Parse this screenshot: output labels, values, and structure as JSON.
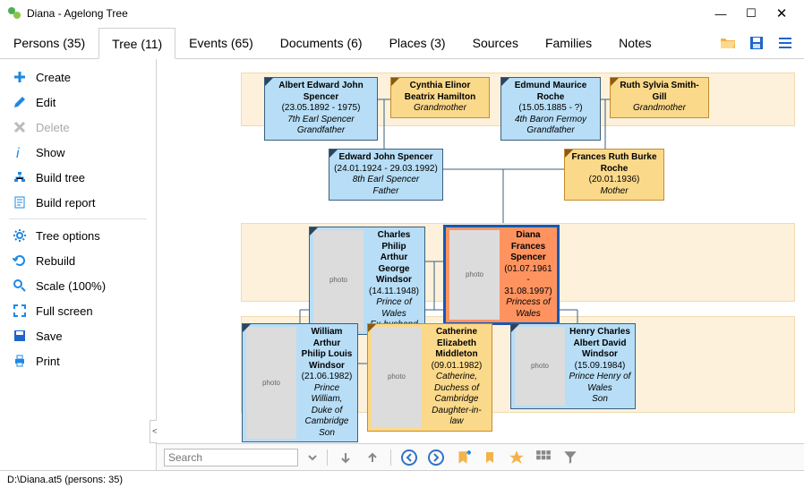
{
  "window": {
    "title": "Diana - Agelong Tree"
  },
  "tabs": [
    {
      "label": "Persons (35)"
    },
    {
      "label": "Tree (11)"
    },
    {
      "label": "Events (65)"
    },
    {
      "label": "Documents (6)"
    },
    {
      "label": "Places (3)"
    },
    {
      "label": "Sources"
    },
    {
      "label": "Families"
    },
    {
      "label": "Notes"
    }
  ],
  "sidebar": {
    "create": "Create",
    "edit": "Edit",
    "delete": "Delete",
    "show": "Show",
    "build_tree": "Build tree",
    "build_report": "Build report",
    "tree_options": "Tree options",
    "rebuild": "Rebuild",
    "scale": "Scale (100%)",
    "full_screen": "Full screen",
    "save": "Save",
    "print": "Print"
  },
  "search": {
    "placeholder": "Search"
  },
  "status": {
    "text": "D:\\Diana.at5 (persons: 35)"
  },
  "people": {
    "albert": {
      "name": "Albert Edward John Spencer",
      "dates": "(23.05.1892 - 1975)",
      "role1": "7th Earl Spencer",
      "role2": "Grandfather"
    },
    "cynthia": {
      "name": "Cynthia Elinor Beatrix Hamilton",
      "role2": "Grandmother"
    },
    "edmund": {
      "name": "Edmund Maurice Roche",
      "dates": "(15.05.1885 - ?)",
      "role1": "4th Baron Fermoy",
      "role2": "Grandfather"
    },
    "ruth": {
      "name": "Ruth Sylvia Smith-Gill",
      "role2": "Grandmother"
    },
    "edward": {
      "name": "Edward John Spencer",
      "dates": "(24.01.1924 - 29.03.1992)",
      "role1": "8th Earl Spencer",
      "role2": "Father"
    },
    "frances": {
      "name": "Frances Ruth Burke Roche",
      "dates": "(20.01.1936)",
      "role2": "Mother"
    },
    "charles": {
      "name": "Charles Philip Arthur George Windsor",
      "dates": "(14.11.1948)",
      "role1": "Prince of Wales",
      "role2": "Ex-husband"
    },
    "diana": {
      "name": "Diana Frances Spencer",
      "dates": "(01.07.1961 - 31.08.1997)",
      "role1": "Princess of Wales"
    },
    "william": {
      "name": "William Arthur Philip Louis Windsor",
      "dates": "(21.06.1982)",
      "role1": "Prince William, Duke of Cambridge",
      "role2": "Son"
    },
    "catherine": {
      "name": "Catherine Elizabeth Middleton",
      "dates": "(09.01.1982)",
      "role1": "Catherine, Duchess of Cambridge",
      "role2": "Daughter-in-law"
    },
    "harry": {
      "name": "Henry Charles Albert David Windsor",
      "dates": "(15.09.1984)",
      "role1": "Prince Henry of Wales",
      "role2": "Son"
    }
  }
}
